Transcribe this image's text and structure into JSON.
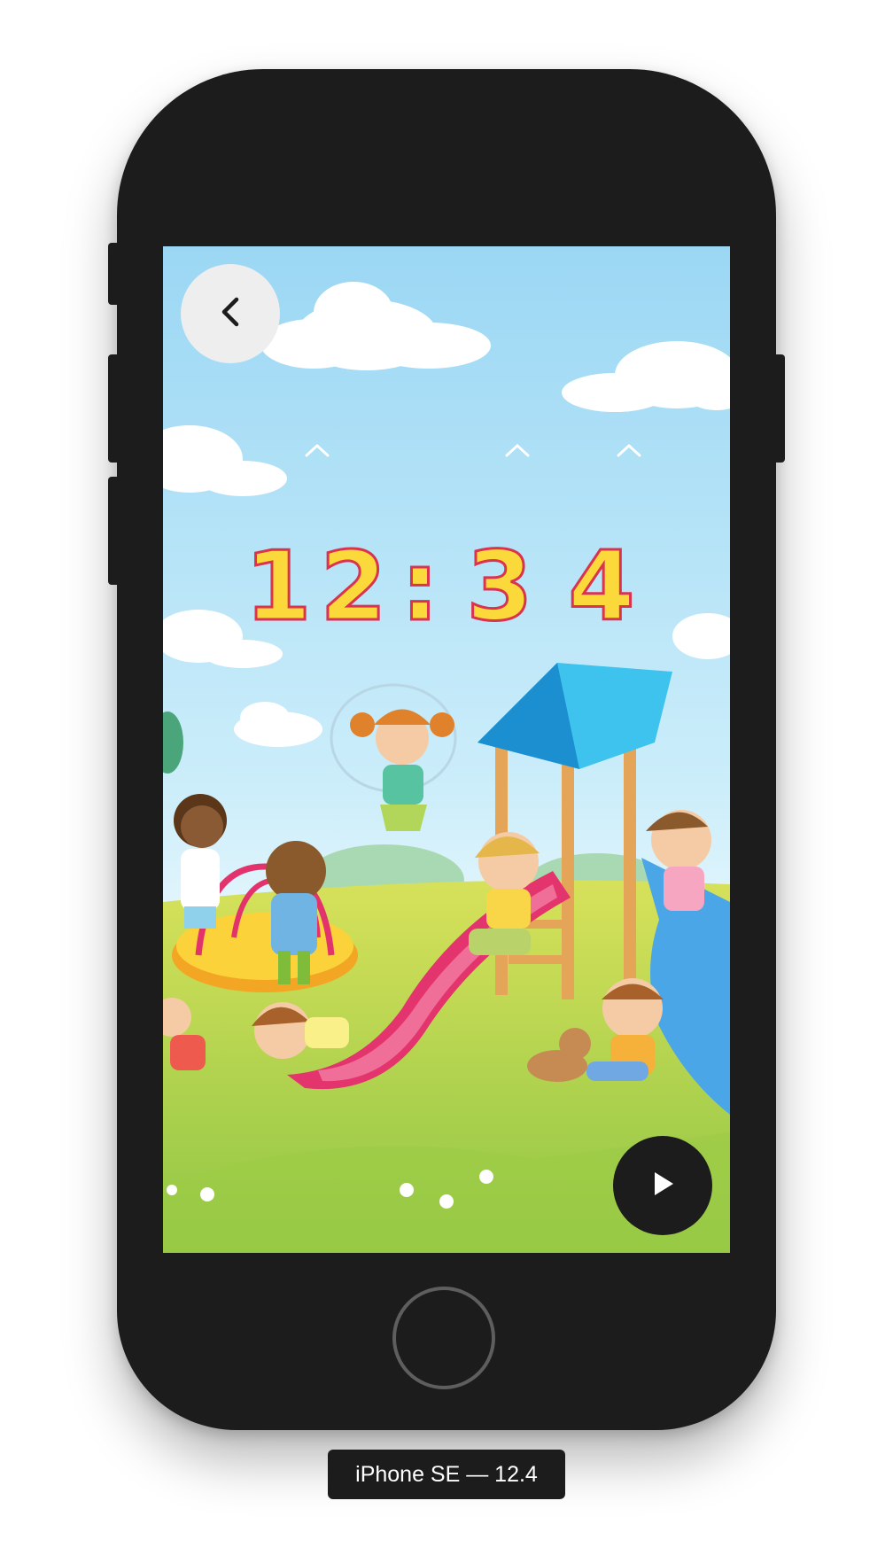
{
  "device": {
    "label": "iPhone SE — 12.4",
    "body_color": "#1c1c1c"
  },
  "app": {
    "back_icon": "chevron-left-icon",
    "play_icon": "play-icon",
    "increment_icon": "chevron-up-icon",
    "decrement_icon": "chevron-down-icon",
    "time": {
      "hour_tens": "1",
      "hour_ones": "2",
      "separator": ":",
      "minute_tens": "3",
      "minute_ones": "4"
    },
    "colors": {
      "digit_fill": "#fcd93a",
      "digit_outline": "#d9334f",
      "sky": "#9dd8f3",
      "grass": "#a8cf45",
      "arrow": "#ffffff"
    }
  }
}
